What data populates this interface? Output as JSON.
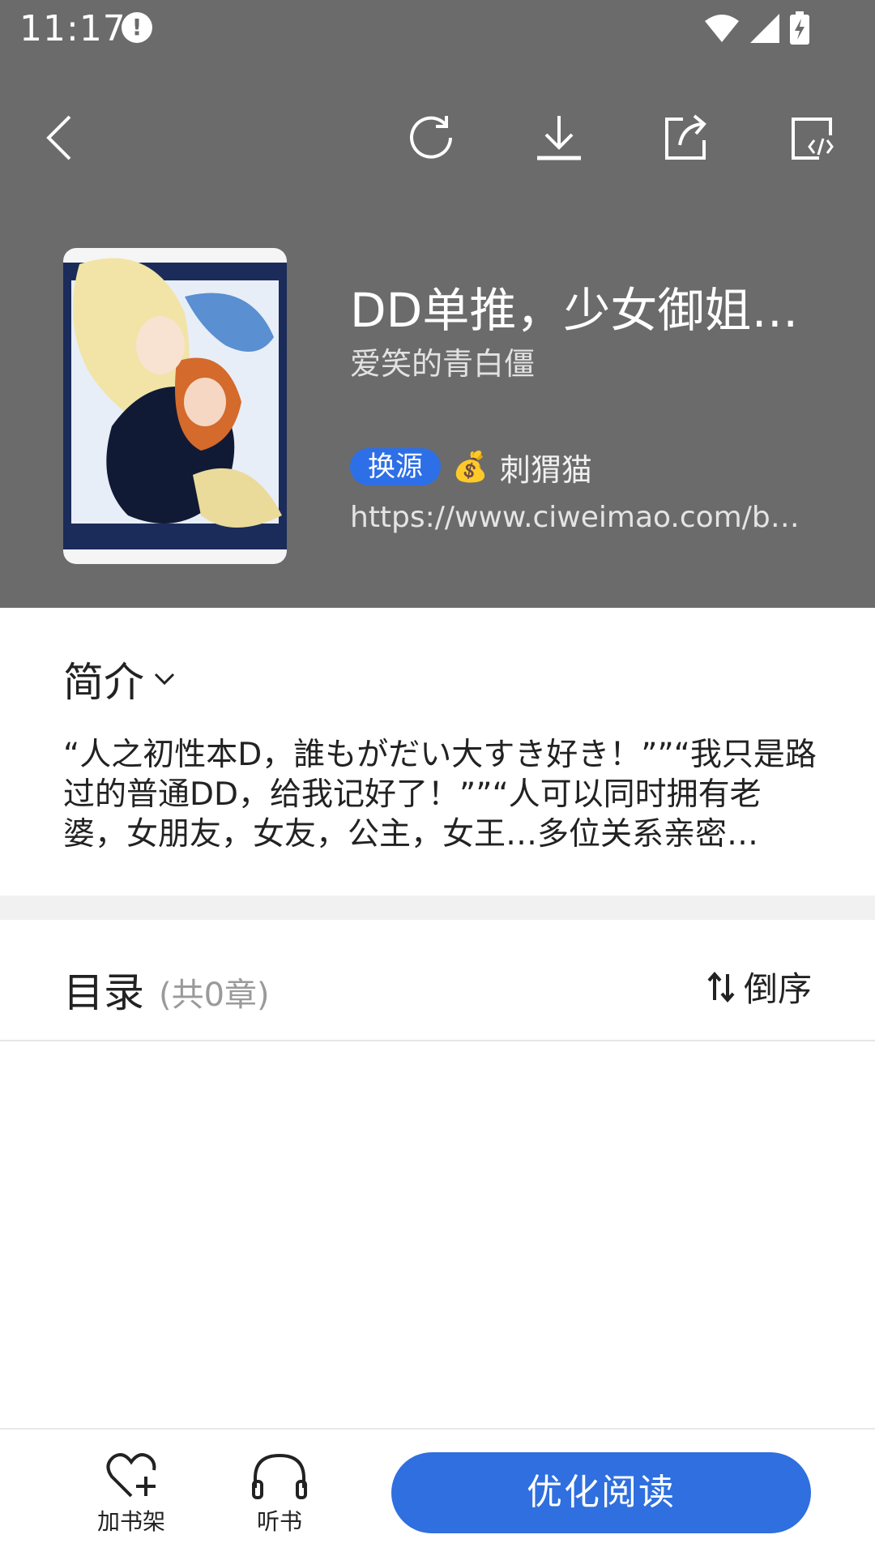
{
  "status_bar": {
    "time": "11:17",
    "icons": [
      "alert-icon",
      "wifi-icon",
      "signal-icon",
      "battery-charging-icon"
    ]
  },
  "toolbar": {
    "icons": [
      "back-icon",
      "refresh-icon",
      "download-icon",
      "share-icon",
      "edit-source-icon"
    ]
  },
  "book": {
    "title": "DD单推，少女御姐…",
    "author": "爱笑的青白僵",
    "change_source_label": "换源",
    "source_emoji": "💰",
    "source_name": "刺猬猫",
    "url": "https://www.ciweimao.com/bo…"
  },
  "intro": {
    "title": "简介",
    "text": "“人之初性本D，誰もがだい大すき好き！””“我只是路过的普通DD，给我记好了！””“人可以同时拥有老婆，女朋友，女友，公主，女王…多位关系亲密…"
  },
  "toc": {
    "title": "目录",
    "count": "(共0章)",
    "order_label": "倒序"
  },
  "bottom_bar": {
    "add_shelf_label": "加书架",
    "listen_label": "听书",
    "read_button_label": "优化阅读"
  },
  "colors": {
    "header_bg": "#6b6b6b",
    "accent": "#2f6fdf"
  }
}
